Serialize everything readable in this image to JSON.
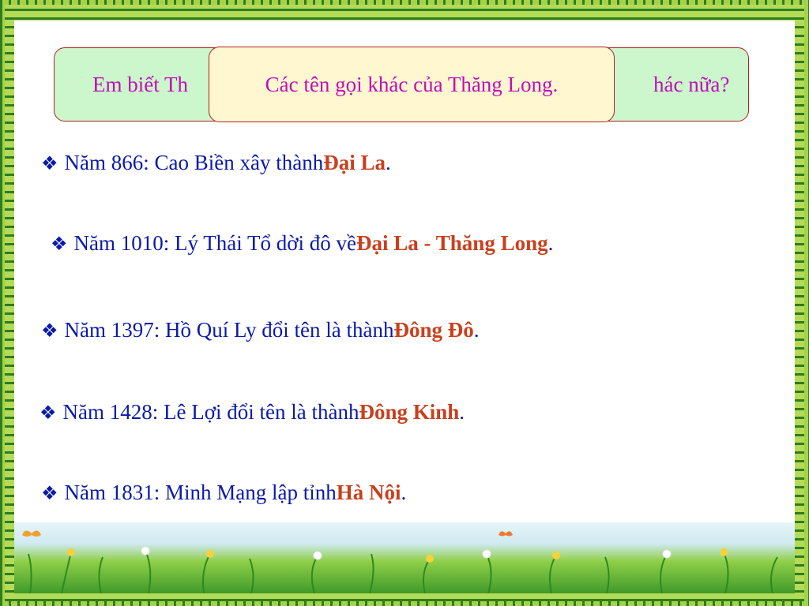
{
  "question": {
    "left_text": "Em biết Th",
    "right_text": "hác nữa?"
  },
  "title": "Các tên gọi khác của Thăng Long.",
  "bullet_icon": "diamond-star-icon",
  "items": [
    {
      "prefix": "Năm 866: Cao Biền xây thành ",
      "highlight": "Đại La",
      "suffix": "."
    },
    {
      "prefix": "Năm 1010: Lý Thái Tổ dời đô về ",
      "highlight": "Đại La - Thăng Long",
      "suffix": "."
    },
    {
      "prefix": "Năm 1397: Hồ Quí Ly đổi tên là thành ",
      "highlight": "Đông Đô",
      "suffix": "."
    },
    {
      "prefix": "Năm 1428: Lê Lợi đổi tên là thành ",
      "highlight": "Đông Kinh",
      "suffix": "."
    },
    {
      "prefix": "Năm 1831: Minh Mạng lập tỉnh ",
      "highlight": "Hà Nội",
      "suffix": "."
    }
  ],
  "colors": {
    "text": "#0a1aa8",
    "highlight": "#c8401e",
    "heading": "#c010b8",
    "question_bg": "#ccf6cc",
    "title_bg": "#fff7cf"
  }
}
